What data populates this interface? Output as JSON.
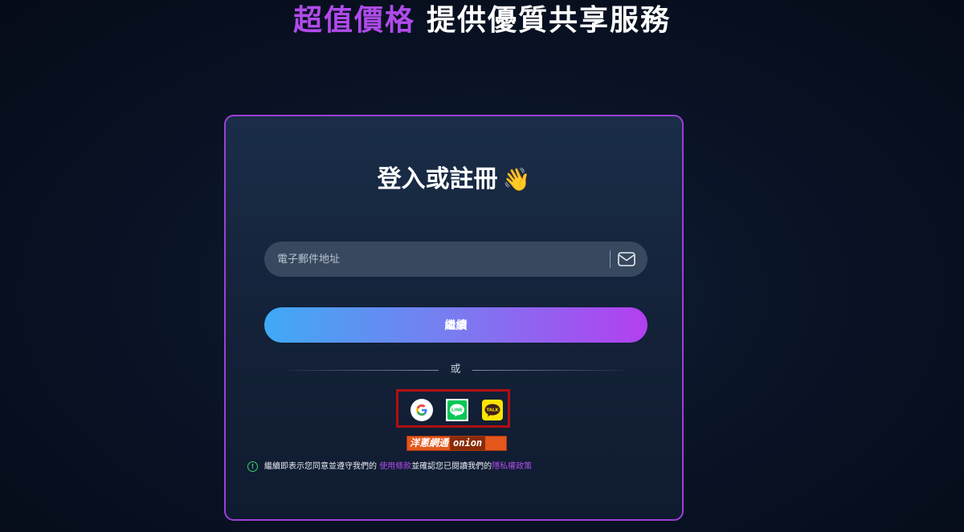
{
  "headline": {
    "accent": "超值價格",
    "rest": "提供優質共享服務"
  },
  "card": {
    "title": "登入或註冊",
    "title_emoji": "👋",
    "email": {
      "placeholder": "電子郵件地址",
      "value": ""
    },
    "continue_label": "繼續",
    "or_label": "或",
    "social": [
      "google-icon",
      "line-icon",
      "kakaotalk-icon"
    ],
    "watermark": {
      "cn": "洋蔥網通",
      "en": "onion"
    },
    "terms": {
      "prefix": "繼續即表示您同意並遵守我們的 ",
      "terms_link": "使用條款",
      "middle": "並確認您已閱讀我們的",
      "privacy_link": "隱私權政策"
    }
  },
  "colors": {
    "accent": "#b04bea",
    "card_border": "#9c3fd9",
    "button_gradient_start": "#3faaf5",
    "button_gradient_end": "#b33ff0",
    "highlight_box": "#b00f12",
    "info_icon": "#38d16b"
  }
}
